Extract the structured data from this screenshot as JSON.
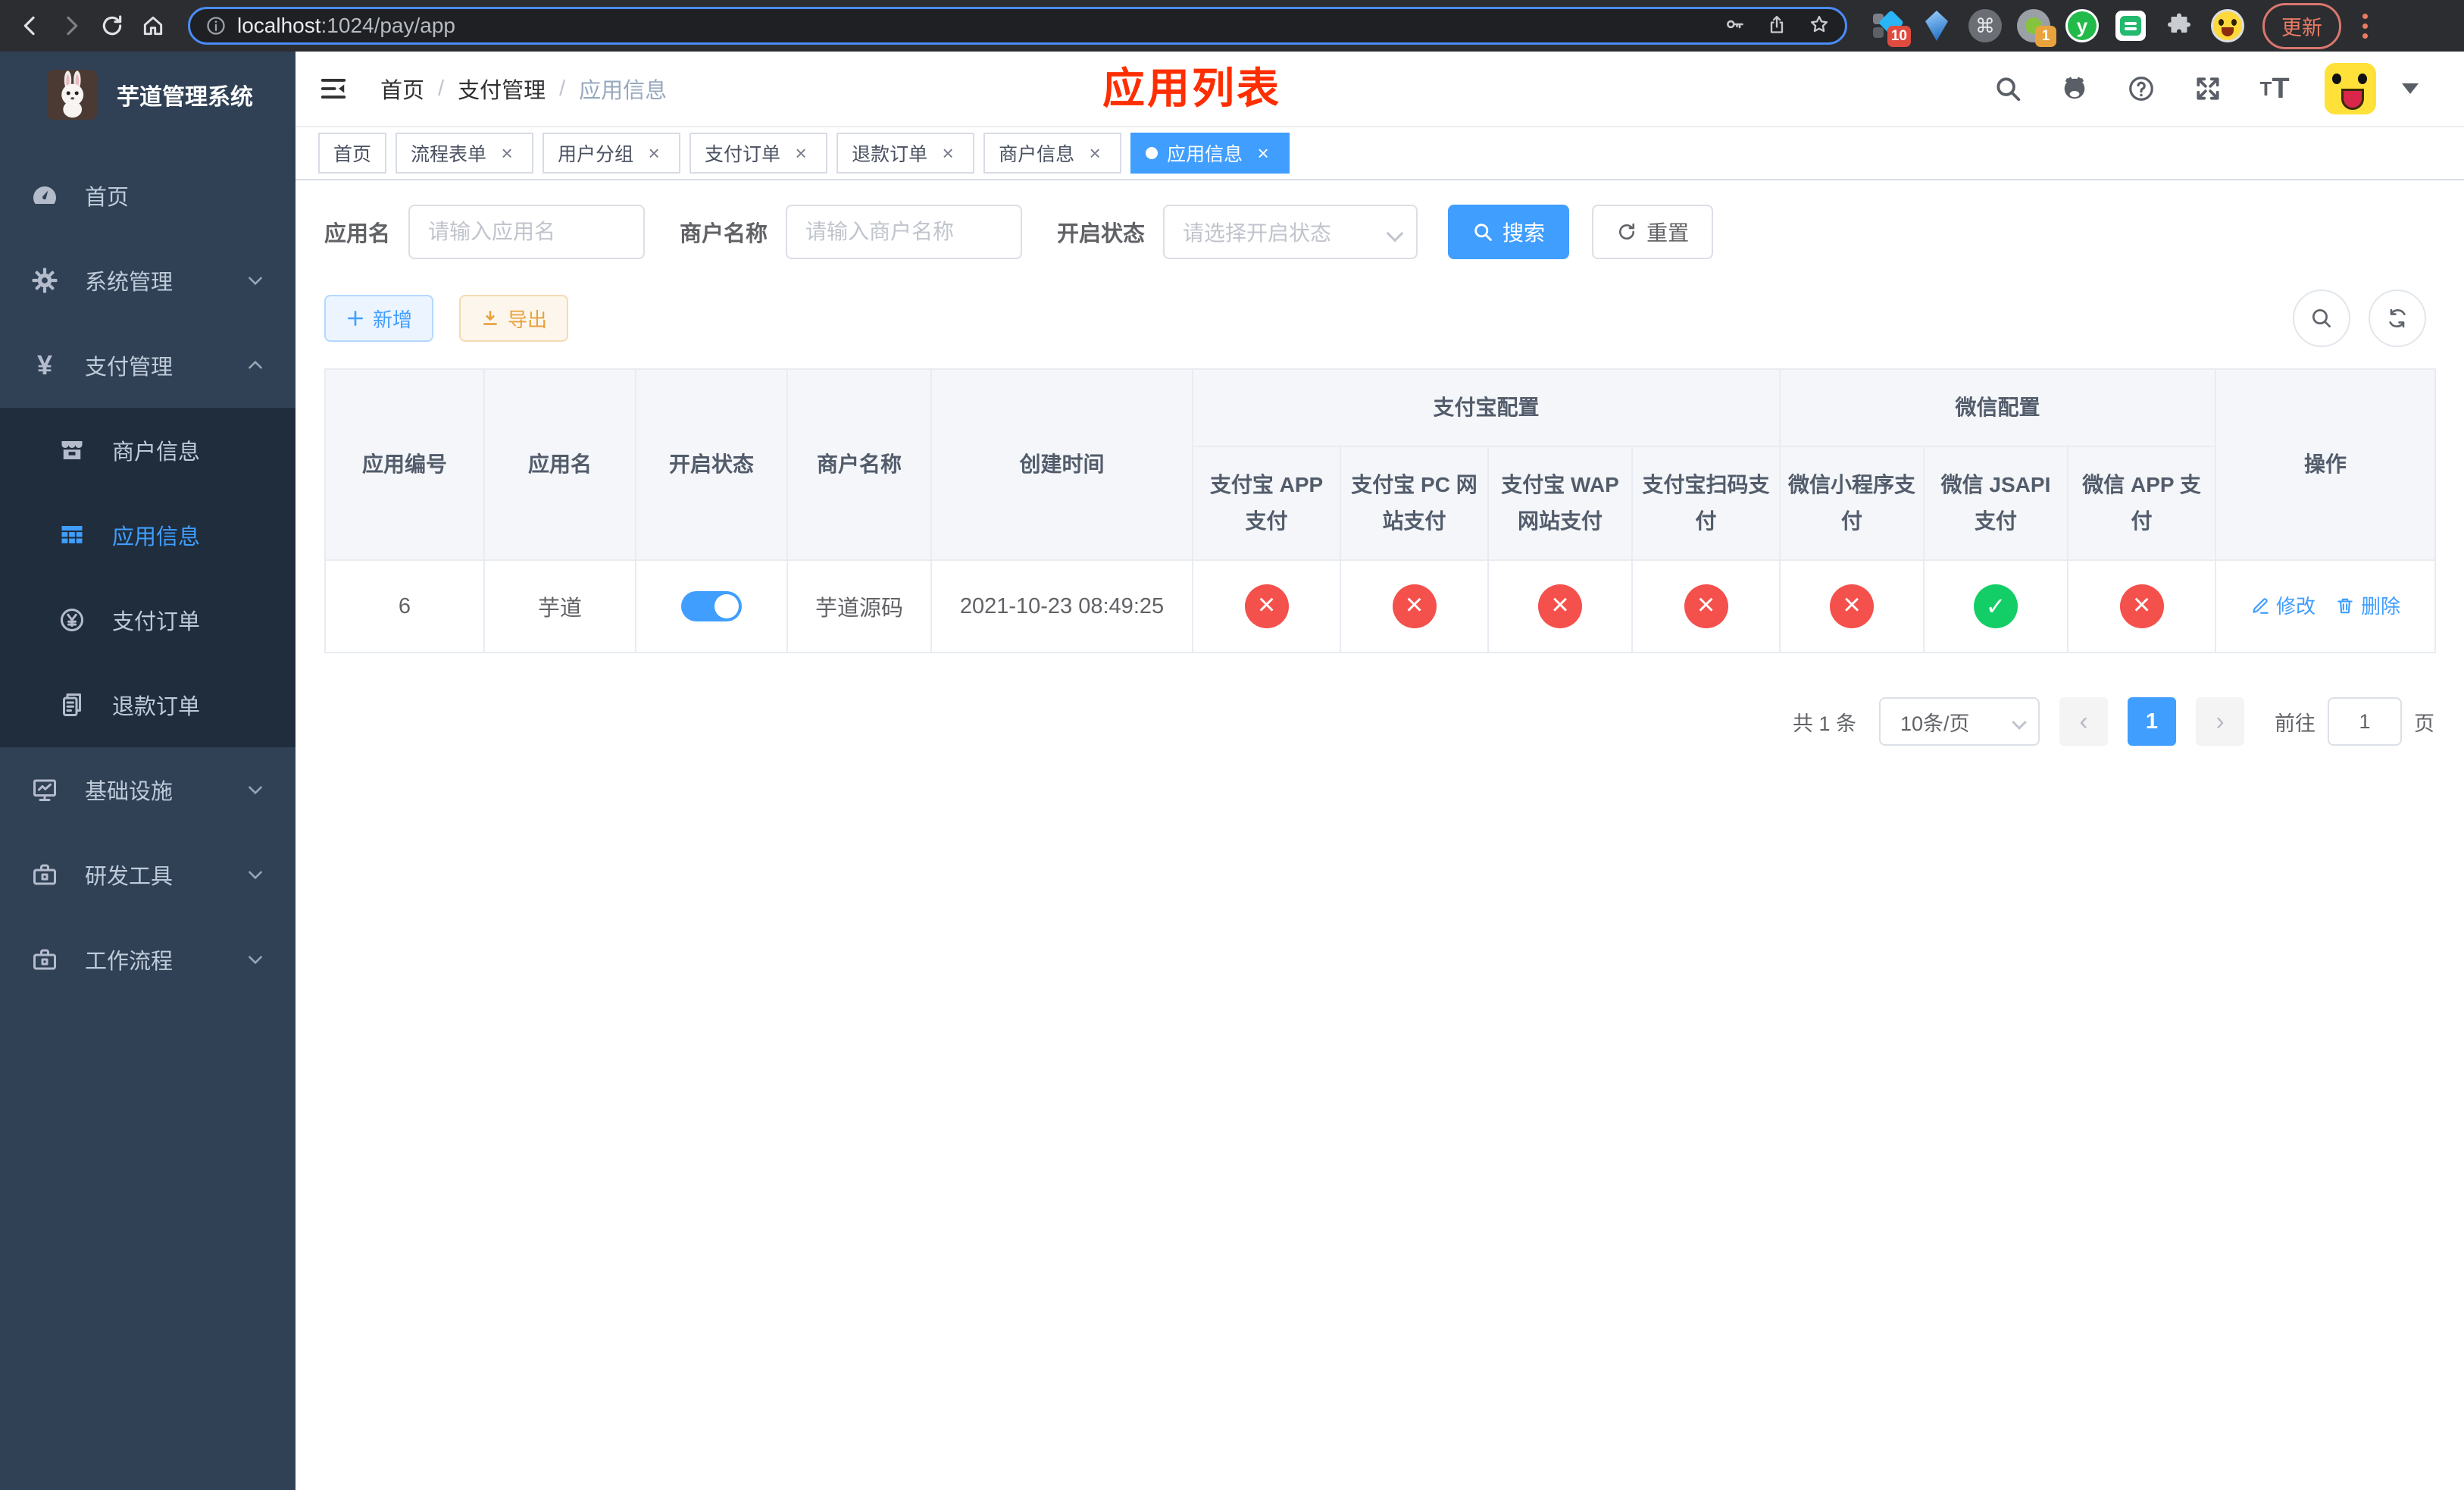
{
  "browser": {
    "url_host": "localhost",
    "url_path": ":1024/pay/app",
    "update_label": "更新",
    "ext_badge_blocks": "10",
    "ext_badge_recorder": "1",
    "ext_letter_y": "y",
    "cmd_glyph": "⌘"
  },
  "sidebar": {
    "title": "芋道管理系统",
    "items": [
      {
        "label": "首页",
        "icon": "dashboard-icon"
      },
      {
        "label": "系统管理",
        "icon": "gear-icon"
      },
      {
        "label": "支付管理",
        "icon": "yen-icon"
      },
      {
        "label": "商户信息",
        "icon": "shop-icon"
      },
      {
        "label": "应用信息",
        "icon": "grid-icon"
      },
      {
        "label": "支付订单",
        "icon": "pay-order-icon"
      },
      {
        "label": "退款订单",
        "icon": "refund-icon"
      },
      {
        "label": "基础设施",
        "icon": "monitor-icon"
      },
      {
        "label": "研发工具",
        "icon": "toolbox-icon"
      },
      {
        "label": "工作流程",
        "icon": "toolbox-icon"
      }
    ]
  },
  "header": {
    "breadcrumb": [
      "首页",
      "支付管理",
      "应用信息"
    ],
    "page_title_overlay": "应用列表"
  },
  "tags": {
    "items": [
      {
        "label": "首页"
      },
      {
        "label": "流程表单"
      },
      {
        "label": "用户分组"
      },
      {
        "label": "支付订单"
      },
      {
        "label": "退款订单"
      },
      {
        "label": "商户信息"
      },
      {
        "label": "应用信息"
      }
    ]
  },
  "filters": {
    "app_name_label": "应用名",
    "app_name_placeholder": "请输入应用名",
    "merchant_label": "商户名称",
    "merchant_placeholder": "请输入商户名称",
    "status_label": "开启状态",
    "status_placeholder": "请选择开启状态",
    "search_label": "搜索",
    "reset_label": "重置"
  },
  "toolbar": {
    "add_label": "新增",
    "export_label": "导出"
  },
  "table": {
    "columns": [
      "应用编号",
      "应用名",
      "开启状态",
      "商户名称",
      "创建时间"
    ],
    "alipay_group": {
      "label": "支付宝配置",
      "cols": [
        "支付宝 APP 支付",
        "支付宝 PC 网站支付",
        "支付宝 WAP 网站支付",
        "支付宝扫码支付"
      ]
    },
    "wechat_group": {
      "label": "微信配置",
      "cols": [
        "微信小程序支付",
        "微信 JSAPI 支付",
        "微信 APP 支付"
      ]
    },
    "action_col": "操作",
    "rows": [
      {
        "id": "6",
        "name": "芋道",
        "enabled": true,
        "merchant": "芋道源码",
        "created": "2021-10-23 08:49:25",
        "statuses": [
          "no",
          "no",
          "no",
          "no",
          "no",
          "yes",
          "no"
        ],
        "edit_label": "修改",
        "delete_label": "删除"
      }
    ]
  },
  "pagination": {
    "total_text": "共 1 条",
    "page_size": "10条/页",
    "current_page": "1",
    "goto_label": "前往",
    "goto_value": "1",
    "page_suffix": "页"
  },
  "colors": {
    "accent": "#409eff",
    "danger": "#f4504c",
    "success": "#13ce66",
    "warning": "#e6a23c",
    "title_red": "#fe2e00",
    "sidebar_bg": "#304156",
    "submenu_bg": "#1f2d3d"
  }
}
